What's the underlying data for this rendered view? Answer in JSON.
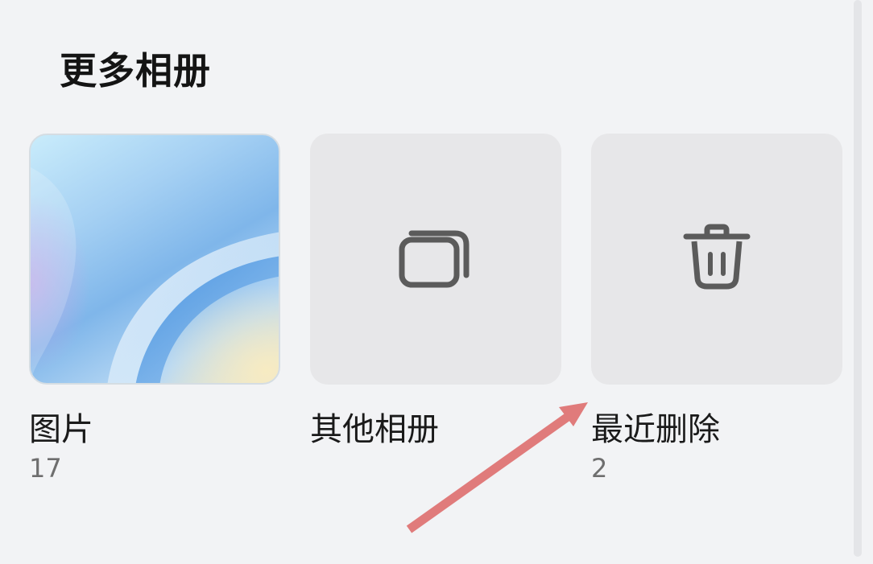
{
  "section": {
    "title": "更多相册"
  },
  "albums": [
    {
      "label": "图片",
      "count": "17",
      "icon": "photo-thumbnail"
    },
    {
      "label": "其他相册",
      "count": "",
      "icon": "stacked-albums-icon"
    },
    {
      "label": "最近删除",
      "count": "2",
      "icon": "trash-icon"
    }
  ],
  "colors": {
    "background": "#f2f3f5",
    "tile": "#e7e7e9",
    "icon": "#5b5b5b",
    "annotation_arrow": "#e07b7b"
  }
}
